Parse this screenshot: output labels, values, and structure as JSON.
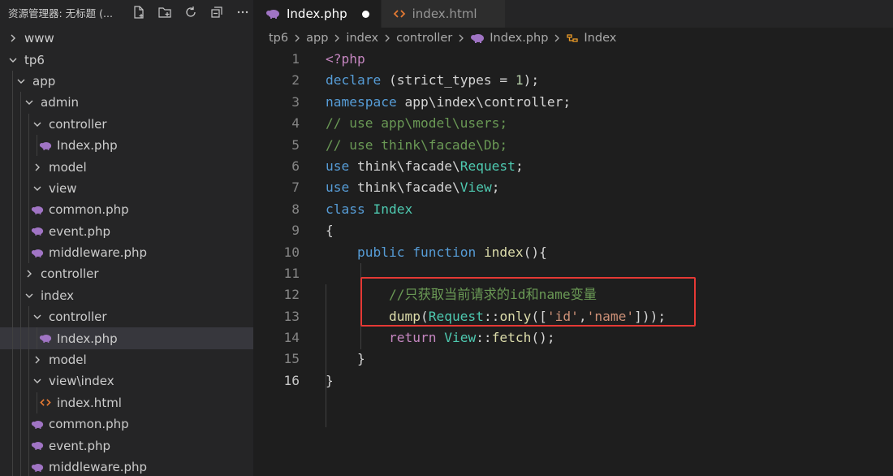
{
  "sidebar": {
    "title": "资源管理器: 无标题 (...",
    "actions": [
      "new-file",
      "new-folder",
      "refresh",
      "collapse-all",
      "more"
    ],
    "tree": [
      {
        "label": "www",
        "depth": 0,
        "kind": "folder",
        "open": false
      },
      {
        "label": "tp6",
        "depth": 0,
        "kind": "folder",
        "open": true
      },
      {
        "label": "app",
        "depth": 1,
        "kind": "folder",
        "open": true
      },
      {
        "label": "admin",
        "depth": 2,
        "kind": "folder",
        "open": true
      },
      {
        "label": "controller",
        "depth": 3,
        "kind": "folder",
        "open": true
      },
      {
        "label": "Index.php",
        "depth": 4,
        "kind": "php"
      },
      {
        "label": "model",
        "depth": 3,
        "kind": "folder",
        "open": false
      },
      {
        "label": "view",
        "depth": 3,
        "kind": "folder",
        "open": true
      },
      {
        "label": "common.php",
        "depth": 3,
        "kind": "php"
      },
      {
        "label": "event.php",
        "depth": 3,
        "kind": "php"
      },
      {
        "label": "middleware.php",
        "depth": 3,
        "kind": "php"
      },
      {
        "label": "controller",
        "depth": 2,
        "kind": "folder",
        "open": false
      },
      {
        "label": "index",
        "depth": 2,
        "kind": "folder",
        "open": true
      },
      {
        "label": "controller",
        "depth": 3,
        "kind": "folder",
        "open": true
      },
      {
        "label": "Index.php",
        "depth": 4,
        "kind": "php",
        "selected": true
      },
      {
        "label": "model",
        "depth": 3,
        "kind": "folder",
        "open": false
      },
      {
        "label": "view\\index",
        "depth": 3,
        "kind": "folder",
        "open": true
      },
      {
        "label": "index.html",
        "depth": 4,
        "kind": "html"
      },
      {
        "label": "common.php",
        "depth": 3,
        "kind": "php"
      },
      {
        "label": "event.php",
        "depth": 3,
        "kind": "php"
      },
      {
        "label": "middleware.php",
        "depth": 3,
        "kind": "php"
      }
    ]
  },
  "tabs": [
    {
      "label": "Index.php",
      "icon": "php-elephant-icon",
      "active": true,
      "dirty": true
    },
    {
      "label": "index.html",
      "icon": "html-brackets-icon",
      "active": false,
      "dirty": false
    }
  ],
  "breadcrumb": [
    "tp6",
    "app",
    "index",
    "controller",
    "Index.php",
    "Index"
  ],
  "code": {
    "current_line": 16,
    "lines": [
      {
        "n": "1",
        "parts": [
          [
            "kc",
            "<?php"
          ]
        ]
      },
      {
        "n": "2",
        "parts": [
          [
            "k",
            "declare"
          ],
          [
            "",
            " (strict_types = "
          ],
          [
            "nu",
            "1"
          ],
          [
            "",
            ");"
          ]
        ]
      },
      {
        "n": "3",
        "parts": [
          [
            "k",
            "namespace"
          ],
          [
            "",
            " app\\index\\controller;"
          ]
        ]
      },
      {
        "n": "4",
        "parts": [
          [
            "cm",
            "// use app\\model\\users;"
          ]
        ]
      },
      {
        "n": "5",
        "parts": [
          [
            "cm",
            "// use think\\facade\\Db;"
          ]
        ]
      },
      {
        "n": "6",
        "parts": [
          [
            "k",
            "use"
          ],
          [
            "",
            " think\\facade\\"
          ],
          [
            "ty",
            "Request"
          ],
          [
            "",
            ";"
          ]
        ]
      },
      {
        "n": "7",
        "parts": [
          [
            "k",
            "use"
          ],
          [
            "",
            " think\\facade\\"
          ],
          [
            "ty",
            "View"
          ],
          [
            "",
            ";"
          ]
        ]
      },
      {
        "n": "8",
        "parts": [
          [
            "k",
            "class"
          ],
          [
            "",
            " "
          ],
          [
            "ty",
            "Index"
          ]
        ]
      },
      {
        "n": "9",
        "parts": [
          [
            "",
            "{"
          ]
        ]
      },
      {
        "n": "10",
        "parts": [
          [
            "",
            "    "
          ],
          [
            "k",
            "public"
          ],
          [
            "",
            " "
          ],
          [
            "k",
            "function"
          ],
          [
            "",
            " "
          ],
          [
            "fn",
            "index"
          ],
          [
            "",
            "(){"
          ]
        ]
      },
      {
        "n": "11",
        "parts": [
          [
            "",
            ""
          ]
        ]
      },
      {
        "n": "12",
        "parts": [
          [
            "",
            "        "
          ],
          [
            "cm",
            "//只获取当前请求的id和name变量"
          ]
        ]
      },
      {
        "n": "13",
        "parts": [
          [
            "",
            "        "
          ],
          [
            "fn",
            "dump"
          ],
          [
            "",
            "("
          ],
          [
            "ty",
            "Request"
          ],
          [
            "",
            "::"
          ],
          [
            "fn",
            "only"
          ],
          [
            "",
            "(["
          ],
          [
            "st",
            "'id'"
          ],
          [
            "",
            ","
          ],
          [
            "st",
            "'name'"
          ],
          [
            "",
            "]));"
          ]
        ]
      },
      {
        "n": "14",
        "parts": [
          [
            "",
            "        "
          ],
          [
            "kc",
            "return"
          ],
          [
            "",
            " "
          ],
          [
            "ty",
            "View"
          ],
          [
            "",
            "::"
          ],
          [
            "fn",
            "fetch"
          ],
          [
            "",
            "();"
          ]
        ]
      },
      {
        "n": "15",
        "parts": [
          [
            "",
            "    }"
          ]
        ]
      },
      {
        "n": "16",
        "parts": [
          [
            "",
            "}"
          ]
        ]
      }
    ]
  },
  "colors": {
    "highlight_box": "#e53935",
    "php_icon": "#a074c4",
    "html_icon": "#e37933"
  }
}
